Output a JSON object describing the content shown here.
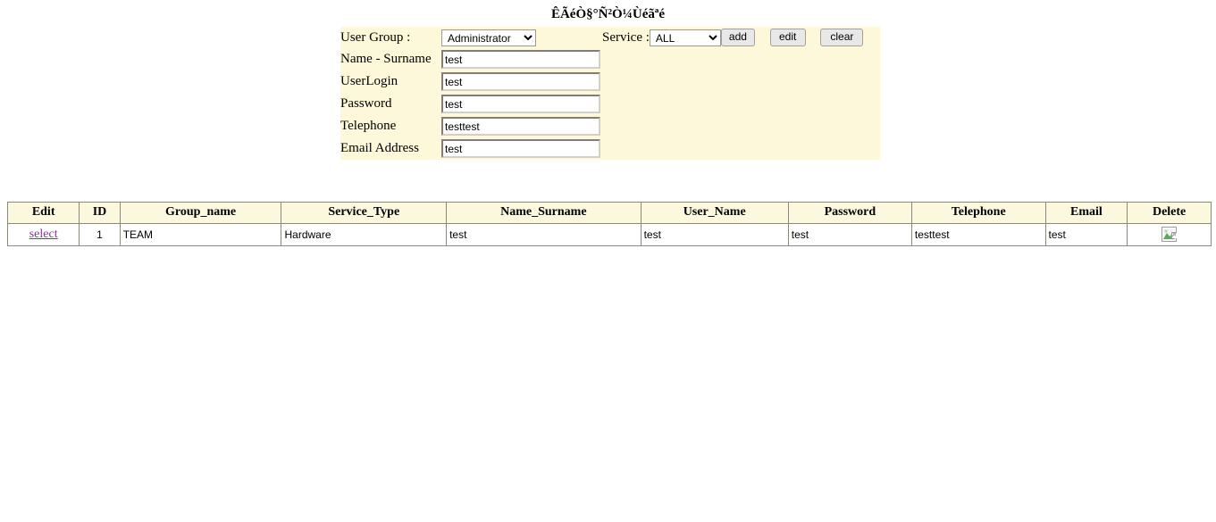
{
  "page": {
    "title": "ÊÃéÒ§°Ñ²Ò¼Ùéãªé"
  },
  "form": {
    "user_group_label": "User Group :",
    "user_group_value": "Administrator",
    "user_group_options": [
      "Administrator"
    ],
    "service_label": "Service :",
    "service_value": "ALL",
    "service_options": [
      "ALL"
    ],
    "buttons": {
      "add": "add",
      "edit": "edit",
      "clear": "clear"
    },
    "fields": [
      {
        "label": "Name - Surname",
        "value": "test",
        "placeholder": ""
      },
      {
        "label": "UserLogin",
        "value": "test",
        "placeholder": ""
      },
      {
        "label": "Password",
        "value": "test",
        "placeholder": ""
      },
      {
        "label": "Telephone",
        "value": "testtest",
        "placeholder": ""
      },
      {
        "label": "Email Address",
        "value": "test",
        "placeholder": ""
      }
    ],
    "panel_color": "#fcf8d9"
  },
  "grid": {
    "headers": [
      "Edit",
      "ID",
      "Group_name",
      "Service_Type",
      "Name_Surname",
      "User_Name",
      "Password",
      "Telephone",
      "Email",
      "Delete"
    ],
    "header_color": "#fbf8dd",
    "rows": [
      {
        "edit": "select",
        "id": "1",
        "group_name": "TEAM",
        "service_type": "Hardware",
        "name_surname": "test",
        "user_name": "test",
        "password": "test",
        "telephone": "testtest",
        "email": "test",
        "delete_icon": "broken-image-icon"
      }
    ]
  }
}
